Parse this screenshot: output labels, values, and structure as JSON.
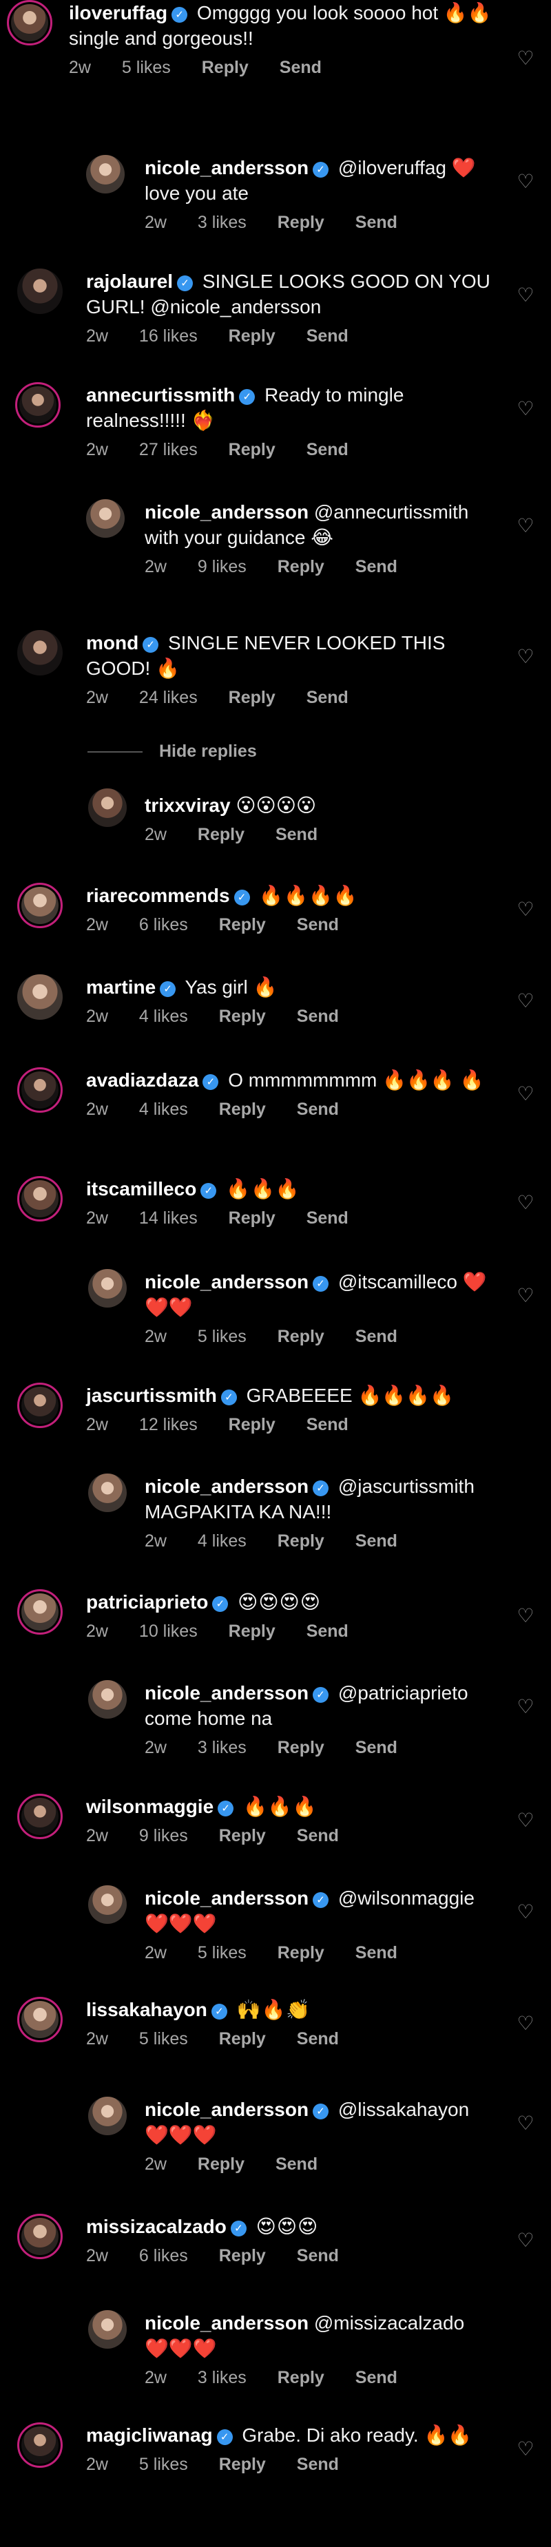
{
  "comments": [
    {
      "username": "iloveruffag",
      "verified": true,
      "text": "Omgggg you look soooo hot 🔥🔥 single and gorgeous!!",
      "time": "2w",
      "likes": "5 likes",
      "reply": "Reply",
      "send": "Send"
    },
    {
      "username": "nicole_andersson",
      "verified": true,
      "text": "@iloveruffag ❤️ love you ate",
      "time": "2w",
      "likes": "3 likes",
      "reply": "Reply",
      "send": "Send"
    },
    {
      "username": "rajolaurel",
      "verified": true,
      "text": "SINGLE LOOKS GOOD ON YOU GURL! @nicole_andersson",
      "time": "2w",
      "likes": "16 likes",
      "reply": "Reply",
      "send": "Send"
    },
    {
      "username": "annecurtissmith",
      "verified": true,
      "text": "Ready to mingle realness!!!!! ❤️‍🔥",
      "time": "2w",
      "likes": "27 likes",
      "reply": "Reply",
      "send": "Send"
    },
    {
      "username": "nicole_andersson",
      "verified": false,
      "text": "@annecurtissmith with your guidance 😂",
      "time": "2w",
      "likes": "9 likes",
      "reply": "Reply",
      "send": "Send"
    },
    {
      "username": "mond",
      "verified": true,
      "text": "SINGLE NEVER LOOKED THIS GOOD! 🔥",
      "time": "2w",
      "likes": "24 likes",
      "reply": "Reply",
      "send": "Send"
    },
    {
      "username": "trixxviray",
      "verified": false,
      "text": "😮😮😮😮",
      "time": "2w",
      "likes": "",
      "reply": "Reply",
      "send": "Send"
    },
    {
      "username": "riarecommends",
      "verified": true,
      "text": "🔥🔥🔥🔥",
      "time": "2w",
      "likes": "6 likes",
      "reply": "Reply",
      "send": "Send"
    },
    {
      "username": "martine",
      "verified": true,
      "text": "Yas girl 🔥",
      "time": "2w",
      "likes": "4 likes",
      "reply": "Reply",
      "send": "Send"
    },
    {
      "username": "avadiazdaza",
      "verified": true,
      "text": "O mmmmmmmm 🔥🔥🔥 🔥",
      "time": "2w",
      "likes": "4 likes",
      "reply": "Reply",
      "send": "Send"
    },
    {
      "username": "itscamilleco",
      "verified": true,
      "text": "🔥🔥🔥",
      "time": "2w",
      "likes": "14 likes",
      "reply": "Reply",
      "send": "Send"
    },
    {
      "username": "nicole_andersson",
      "verified": true,
      "text": "@itscamilleco ❤️❤️❤️",
      "time": "2w",
      "likes": "5 likes",
      "reply": "Reply",
      "send": "Send"
    },
    {
      "username": "jascurtissmith",
      "verified": true,
      "text": "GRABEEEE 🔥🔥🔥🔥",
      "time": "2w",
      "likes": "12 likes",
      "reply": "Reply",
      "send": "Send"
    },
    {
      "username": "nicole_andersson",
      "verified": true,
      "text": "@jascurtissmith MAGPAKITA KA NA!!!",
      "time": "2w",
      "likes": "4 likes",
      "reply": "Reply",
      "send": "Send"
    },
    {
      "username": "patriciaprieto",
      "verified": true,
      "text": "😍😍😍😍",
      "time": "2w",
      "likes": "10 likes",
      "reply": "Reply",
      "send": "Send"
    },
    {
      "username": "nicole_andersson",
      "verified": true,
      "text": "@patriciaprieto come home na",
      "time": "2w",
      "likes": "3 likes",
      "reply": "Reply",
      "send": "Send"
    },
    {
      "username": "wilsonmaggie",
      "verified": true,
      "text": "🔥🔥🔥",
      "time": "2w",
      "likes": "9 likes",
      "reply": "Reply",
      "send": "Send"
    },
    {
      "username": "nicole_andersson",
      "verified": true,
      "text": "@wilsonmaggie ❤️❤️❤️",
      "time": "2w",
      "likes": "5 likes",
      "reply": "Reply",
      "send": "Send"
    },
    {
      "username": "lissakahayon",
      "verified": true,
      "text": "🙌🔥👏",
      "time": "2w",
      "likes": "5 likes",
      "reply": "Reply",
      "send": "Send"
    },
    {
      "username": "nicole_andersson",
      "verified": true,
      "text": "@lissakahayon ❤️❤️❤️",
      "time": "2w",
      "likes": "",
      "reply": "Reply",
      "send": "Send"
    },
    {
      "username": "missizacalzado",
      "verified": true,
      "text": "😍😍😍",
      "time": "2w",
      "likes": "6 likes",
      "reply": "Reply",
      "send": "Send"
    },
    {
      "username": "nicole_andersson",
      "verified": false,
      "text": "@missizacalzado ❤️❤️❤️",
      "time": "2w",
      "likes": "3 likes",
      "reply": "Reply",
      "send": "Send"
    },
    {
      "username": "magicliwanag",
      "verified": true,
      "text": "Grabe. Di ako ready. 🔥🔥",
      "time": "2w",
      "likes": "5 likes",
      "reply": "Reply",
      "send": "Send"
    }
  ],
  "hide_replies": "Hide replies",
  "colors": {
    "background": "#000000",
    "text": "#f5f5f5",
    "muted": "#a8a8a8",
    "verified": "#3897f0",
    "story_ring": "#c21f7a"
  }
}
